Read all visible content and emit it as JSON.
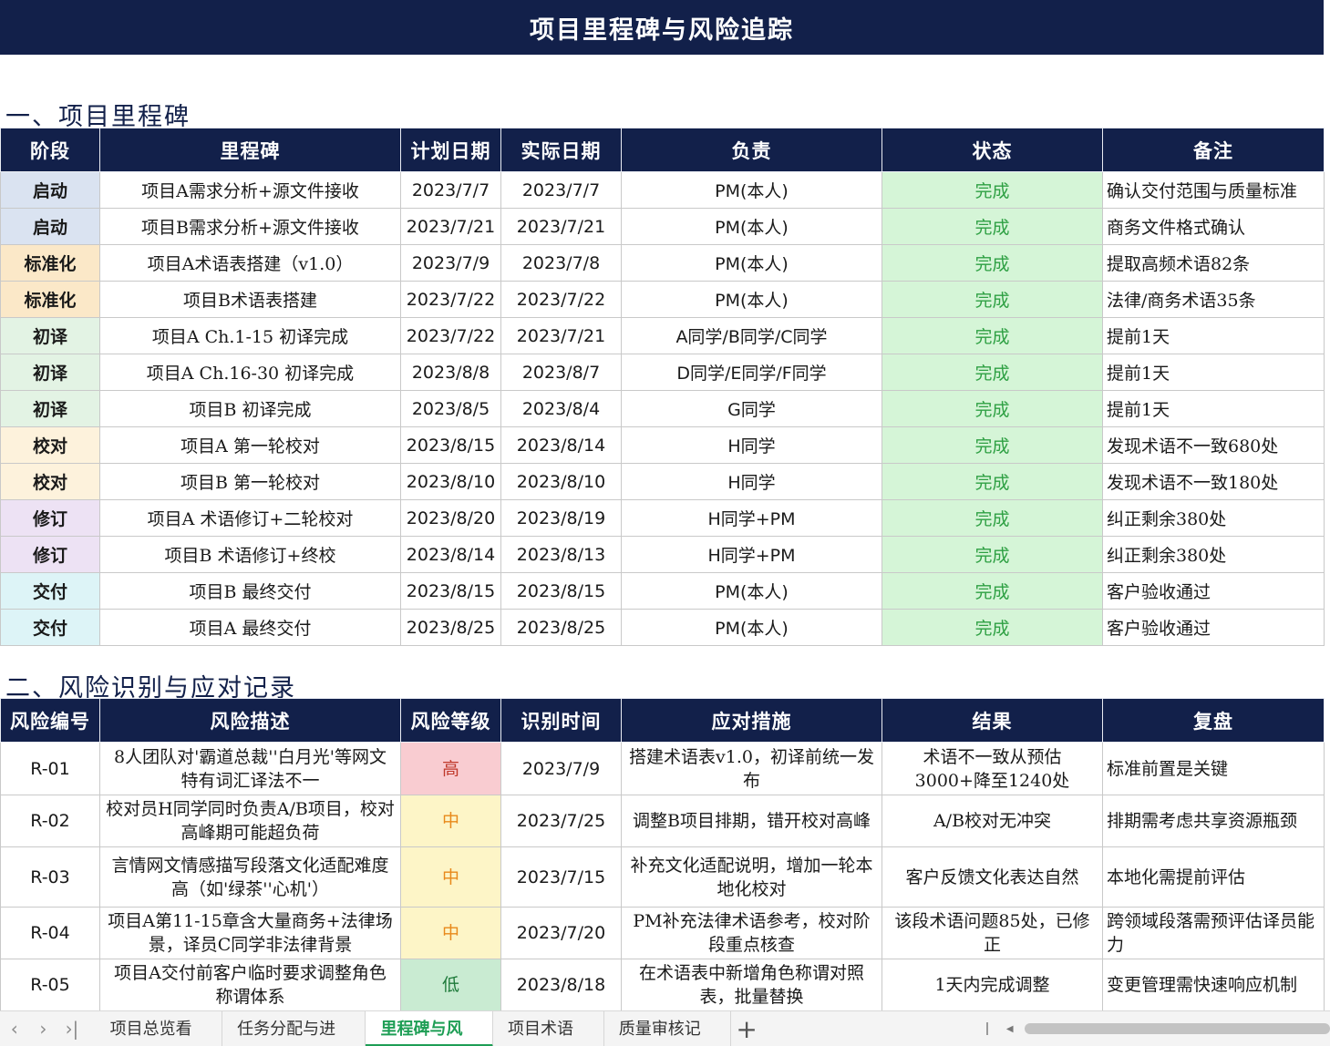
{
  "title": "项目里程碑与风险追踪",
  "section1_title": "一、项目里程碑",
  "section2_title": "二、风险识别与应对记录",
  "milestones": {
    "headers": [
      "阶段",
      "里程碑",
      "计划日期",
      "实际日期",
      "负责",
      "状态",
      "备注"
    ],
    "rows": [
      {
        "stage": "启动",
        "milestone": "项目A需求分析+源文件接收",
        "planned": "2023/7/7",
        "actual": "2023/7/7",
        "owner": "PM(本人)",
        "status": "完成",
        "note": "确认交付范围与质量标准"
      },
      {
        "stage": "启动",
        "milestone": "项目B需求分析+源文件接收",
        "planned": "2023/7/21",
        "actual": "2023/7/21",
        "owner": "PM(本人)",
        "status": "完成",
        "note": "商务文件格式确认"
      },
      {
        "stage": "标准化",
        "milestone": "项目A术语表搭建（v1.0）",
        "planned": "2023/7/9",
        "actual": "2023/7/8",
        "owner": "PM(本人)",
        "status": "完成",
        "note": "提取高频术语82条"
      },
      {
        "stage": "标准化",
        "milestone": "项目B术语表搭建",
        "planned": "2023/7/22",
        "actual": "2023/7/22",
        "owner": "PM(本人)",
        "status": "完成",
        "note": "法律/商务术语35条"
      },
      {
        "stage": "初译",
        "milestone": "项目A Ch.1-15 初译完成",
        "planned": "2023/7/22",
        "actual": "2023/7/21",
        "owner": "A同学/B同学/C同学",
        "status": "完成",
        "note": "提前1天"
      },
      {
        "stage": "初译",
        "milestone": "项目A Ch.16-30 初译完成",
        "planned": "2023/8/8",
        "actual": "2023/8/7",
        "owner": "D同学/E同学/F同学",
        "status": "完成",
        "note": "提前1天"
      },
      {
        "stage": "初译",
        "milestone": "项目B 初译完成",
        "planned": "2023/8/5",
        "actual": "2023/8/4",
        "owner": "G同学",
        "status": "完成",
        "note": "提前1天"
      },
      {
        "stage": "校对",
        "milestone": "项目A 第一轮校对",
        "planned": "2023/8/15",
        "actual": "2023/8/14",
        "owner": "H同学",
        "status": "完成",
        "note": "发现术语不一致680处"
      },
      {
        "stage": "校对",
        "milestone": "项目B 第一轮校对",
        "planned": "2023/8/10",
        "actual": "2023/8/10",
        "owner": "H同学",
        "status": "完成",
        "note": "发现术语不一致180处"
      },
      {
        "stage": "修订",
        "milestone": "项目A 术语修订+二轮校对",
        "planned": "2023/8/20",
        "actual": "2023/8/19",
        "owner": "H同学+PM",
        "status": "完成",
        "note": "纠正剩余380处"
      },
      {
        "stage": "修订",
        "milestone": "项目B 术语修订+终校",
        "planned": "2023/8/14",
        "actual": "2023/8/13",
        "owner": "H同学+PM",
        "status": "完成",
        "note": "纠正剩余380处"
      },
      {
        "stage": "交付",
        "milestone": "项目B 最终交付",
        "planned": "2023/8/15",
        "actual": "2023/8/15",
        "owner": "PM(本人)",
        "status": "完成",
        "note": "客户验收通过"
      },
      {
        "stage": "交付",
        "milestone": "项目A 最终交付",
        "planned": "2023/8/25",
        "actual": "2023/8/25",
        "owner": "PM(本人)",
        "status": "完成",
        "note": "客户验收通过"
      }
    ]
  },
  "stage_colors": {
    "启动": "#dae3f1",
    "标准化": "#fbe8c8",
    "初译": "#e3f3e4",
    "校对": "#fdf2dc",
    "修订": "#ede2f4",
    "交付": "#ddf4f7"
  },
  "risks": {
    "headers": [
      "风险编号",
      "风险描述",
      "风险等级",
      "识别时间",
      "应对措施",
      "结果",
      "复盘"
    ],
    "rows": [
      {
        "id": "R-01",
        "desc": "8人团队对'霸道总裁''白月光'等网文特有词汇译法不一",
        "level": "高",
        "date": "2023/7/9",
        "measure": "搭建术语表v1.0，初译前统一发布",
        "result": "术语不一致从预估3000+降至1240处",
        "review": "标准前置是关键"
      },
      {
        "id": "R-02",
        "desc": "校对员H同学同时负责A/B项目，校对高峰期可能超负荷",
        "level": "中",
        "date": "2023/7/25",
        "measure": "调整B项目排期，错开校对高峰",
        "result": "A/B校对无冲突",
        "review": "排期需考虑共享资源瓶颈"
      },
      {
        "id": "R-03",
        "desc": "言情网文情感描写段落文化适配难度高（如'绿茶''心机'）",
        "level": "中",
        "date": "2023/7/15",
        "measure": "补充文化适配说明，增加一轮本地化校对",
        "result": "客户反馈文化表达自然",
        "review": "本地化需提前评估"
      },
      {
        "id": "R-04",
        "desc": "项目A第11-15章含大量商务+法律场景，译员C同学非法律背景",
        "level": "中",
        "date": "2023/7/20",
        "measure": "PM补充法律术语参考，校对阶段重点核查",
        "result": "该段术语问题85处，已修正",
        "review": "跨领域段落需预评估译员能力"
      },
      {
        "id": "R-05",
        "desc": "项目A交付前客户临时要求调整角色称谓体系",
        "level": "低",
        "date": "2023/8/18",
        "measure": "在术语表中新增角色称谓对照表，批量替换",
        "result": "1天内完成调整",
        "review": "变更管理需快速响应机制"
      }
    ]
  },
  "level_colors": {
    "高": {
      "bg": "#f9ccd1",
      "fg": "#c0392b"
    },
    "中": {
      "bg": "#fdf5c7",
      "fg": "#e8891a"
    },
    "低": {
      "bg": "#c9ebd2",
      "fg": "#1e7a3a"
    }
  },
  "status_colors": {
    "bg": "#d5f5d7",
    "fg": "#2ea043"
  },
  "sheet_tabs": [
    "项目总览看板",
    "任务分配与进度",
    "里程碑与风险",
    "项目术语表",
    "质量审核记录"
  ],
  "active_tab": "里程碑与风险",
  "nav_icons": [
    "chevron-left-icon",
    "chevron-right-icon",
    "last-sheet-icon"
  ]
}
